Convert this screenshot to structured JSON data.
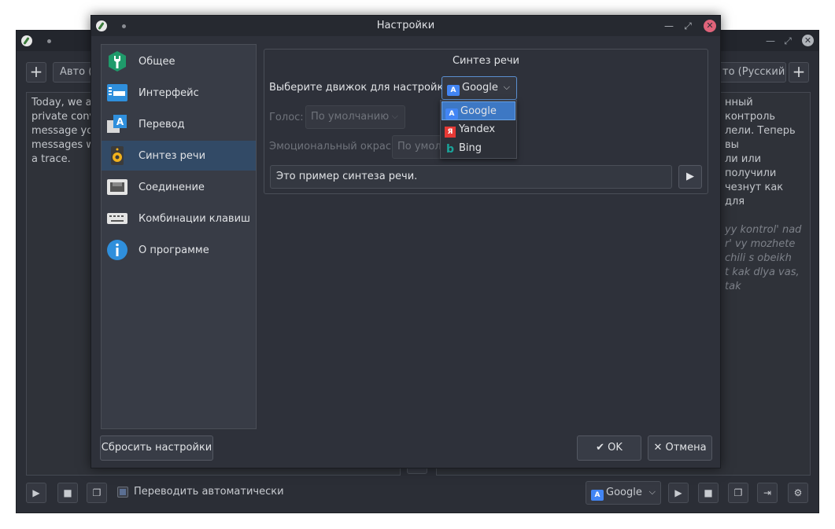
{
  "main_window": {
    "source_lang": "Авто (А",
    "target_lang": "то (Русский)",
    "source_text": [
      "Today, we are",
      "private conve",
      "message you",
      "messages wil",
      "a trace."
    ],
    "target_text": [
      "нный контроль",
      "лели. Теперь вы",
      "ли или получили",
      "чезнут как для"
    ],
    "translit_text": [
      "yy kontrol' nad",
      "r' vy mozhete",
      "chili s obeikh",
      "t kak dlya vas, tak"
    ],
    "auto_translate_label": "Переводить автоматически",
    "engine": "Google"
  },
  "dialog": {
    "title": "Настройки",
    "sidebar": [
      {
        "label": "Общее",
        "icon": "general-settings-icon"
      },
      {
        "label": "Интерфейс",
        "icon": "interface-icon"
      },
      {
        "label": "Перевод",
        "icon": "translation-icon"
      },
      {
        "label": "Синтез речи",
        "icon": "speaker-icon"
      },
      {
        "label": "Соединение",
        "icon": "network-icon"
      },
      {
        "label": "Комбинации клавиш",
        "icon": "keyboard-icon"
      },
      {
        "label": "О программе",
        "icon": "info-icon"
      }
    ],
    "active_index": 3,
    "group_title": "Синтез речи",
    "engine_label": "Выберите движок для настройки:",
    "engine_value": "Google",
    "voice_label": "Голос:",
    "voice_value": "По умолчанию",
    "emotion_label": "Эмоциональный окрас:",
    "emotion_value": "По умол",
    "sample_text": "Это пример синтеза речи.",
    "engine_options": [
      "Google",
      "Yandex",
      "Bing"
    ],
    "reset_label": "Сбросить настройки",
    "ok_label": "OK",
    "cancel_label": "Отмена"
  },
  "colors": {
    "accent": "#3d78c4",
    "active_item": "#324a66",
    "close_button": "#e0637a"
  }
}
